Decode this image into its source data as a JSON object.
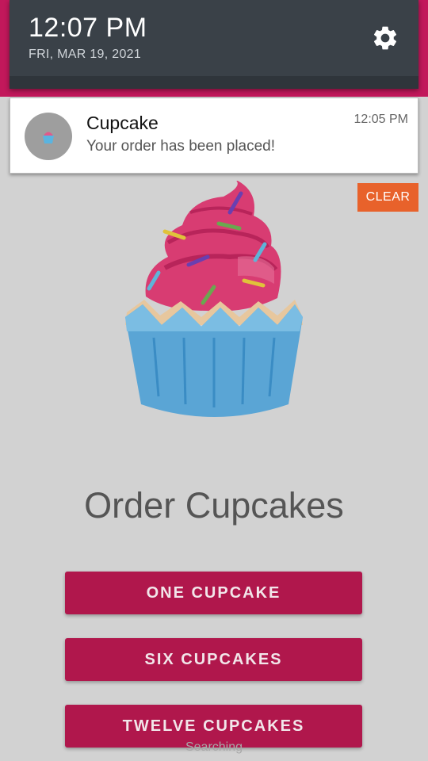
{
  "status_shade": {
    "time": "12:07 PM",
    "date": "FRI, MAR 19, 2021",
    "settings_icon": "gear-icon"
  },
  "notification": {
    "app_name": "Cupcake",
    "message": "Your order has been placed!",
    "time": "12:05 PM",
    "icon": "cupcake-icon"
  },
  "clear_label": "CLEAR",
  "main": {
    "title": "Order Cupcakes",
    "buttons": [
      {
        "label": "ONE CUPCAKE"
      },
      {
        "label": "SIX CUPCAKES"
      },
      {
        "label": "TWELVE CUPCAKES"
      }
    ],
    "toast": "Searching"
  },
  "colors": {
    "accent": "#b0174c",
    "clear": "#e8622b",
    "shade": "#3a4148"
  }
}
